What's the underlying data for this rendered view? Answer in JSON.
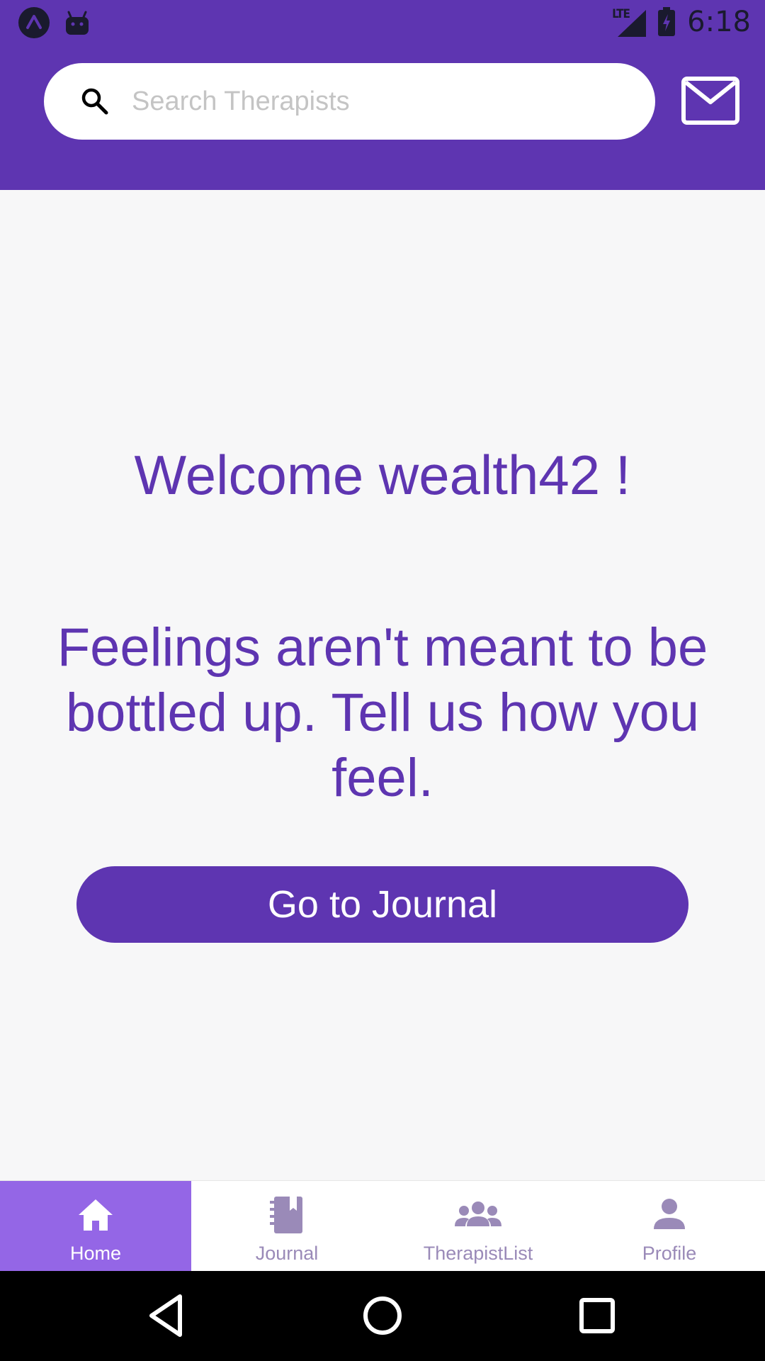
{
  "colors": {
    "primary": "#5e35b1",
    "nav_active_bg": "#9466e6",
    "nav_inactive": "#9a8ab8",
    "background": "#f7f7f8"
  },
  "status_bar": {
    "time": "6:18",
    "network": "LTE",
    "icons": [
      "expo-icon",
      "android-debug-icon",
      "signal-icon",
      "battery-charging-icon"
    ]
  },
  "search": {
    "placeholder": "Search Therapists",
    "value": ""
  },
  "header": {
    "mail_icon": "mail-icon"
  },
  "main": {
    "welcome": "Welcome wealth42 !",
    "tagline": "Feelings aren't meant to be bottled up. Tell us how you feel.",
    "journal_button": "Go to Journal"
  },
  "bottom_nav": {
    "items": [
      {
        "label": "Home",
        "icon": "home-icon",
        "active": true
      },
      {
        "label": "Journal",
        "icon": "journal-icon",
        "active": false
      },
      {
        "label": "TherapistList",
        "icon": "people-icon",
        "active": false
      },
      {
        "label": "Profile",
        "icon": "person-icon",
        "active": false
      }
    ]
  },
  "system_nav": {
    "icons": [
      "back-icon",
      "home-circle-icon",
      "recents-icon"
    ]
  }
}
